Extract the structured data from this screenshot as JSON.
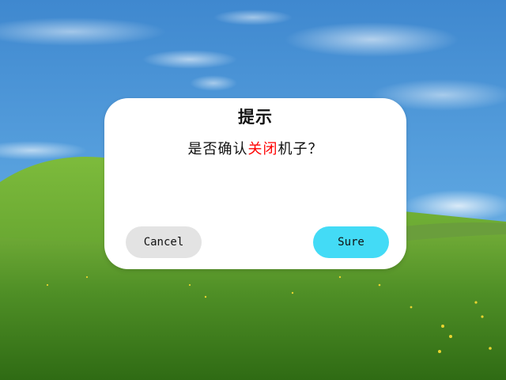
{
  "dialog": {
    "title": "提示",
    "message_before": "是否确认",
    "message_highlight": "关闭",
    "message_after": "机子？",
    "cancel_label": "Cancel",
    "sure_label": "Sure"
  },
  "colors": {
    "highlight": "#ff0000",
    "sure_button": "#43dbf6",
    "cancel_button": "#e3e3e3"
  }
}
